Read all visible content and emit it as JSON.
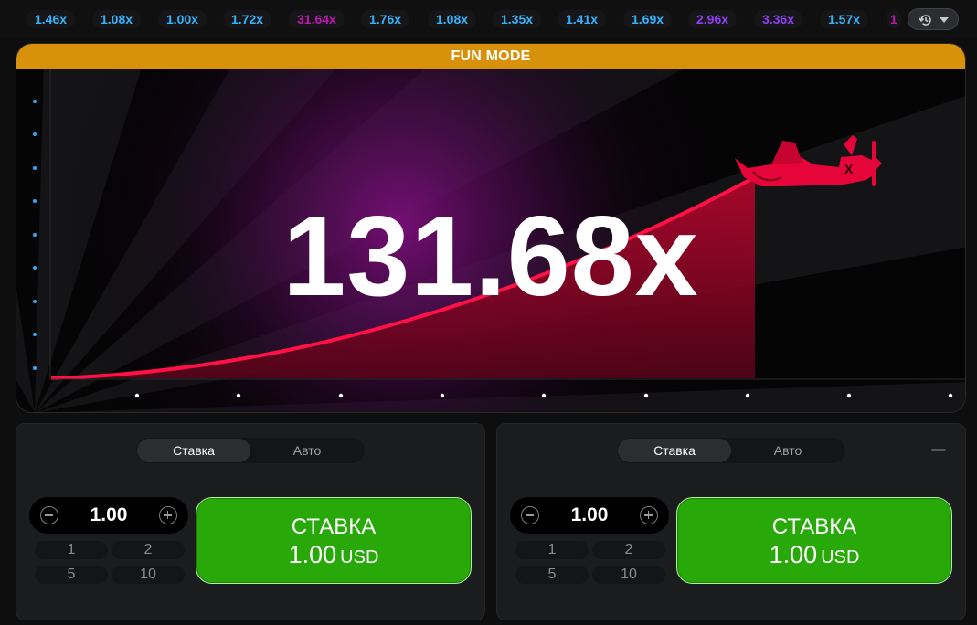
{
  "history": {
    "items": [
      {
        "value": "1.46x",
        "color": "blue"
      },
      {
        "value": "1.08x",
        "color": "blue"
      },
      {
        "value": "1.00x",
        "color": "blue"
      },
      {
        "value": "1.72x",
        "color": "blue"
      },
      {
        "value": "31.64x",
        "color": "magenta"
      },
      {
        "value": "1.76x",
        "color": "blue"
      },
      {
        "value": "1.08x",
        "color": "blue"
      },
      {
        "value": "1.35x",
        "color": "blue"
      },
      {
        "value": "1.41x",
        "color": "blue"
      },
      {
        "value": "1.69x",
        "color": "blue"
      },
      {
        "value": "2.96x",
        "color": "purple"
      },
      {
        "value": "3.36x",
        "color": "purple"
      },
      {
        "value": "1.57x",
        "color": "blue"
      },
      {
        "value": "1",
        "color": "magenta"
      }
    ],
    "toggle_icons": [
      "history-icon",
      "chevron-down-icon"
    ]
  },
  "game": {
    "mode_banner": "FUN MODE",
    "multiplier": "131.68x",
    "plane_icon": "airplane-icon",
    "colors": {
      "banner": "#d7910a",
      "curve": "#e50539",
      "glow": "#7a0f7a"
    }
  },
  "panels": [
    {
      "tabs": [
        "Ставка",
        "Авто"
      ],
      "active_tab": "Ставка",
      "amount": "1.00",
      "quick_amounts": [
        "1",
        "2",
        "5",
        "10"
      ],
      "bet_button": {
        "label": "СТАВКА",
        "amount": "1.00",
        "currency": "USD"
      },
      "has_collapse": false
    },
    {
      "tabs": [
        "Ставка",
        "Авто"
      ],
      "active_tab": "Ставка",
      "amount": "1.00",
      "quick_amounts": [
        "1",
        "2",
        "5",
        "10"
      ],
      "bet_button": {
        "label": "СТАВКА",
        "amount": "1.00",
        "currency": "USD"
      },
      "has_collapse": true
    }
  ]
}
